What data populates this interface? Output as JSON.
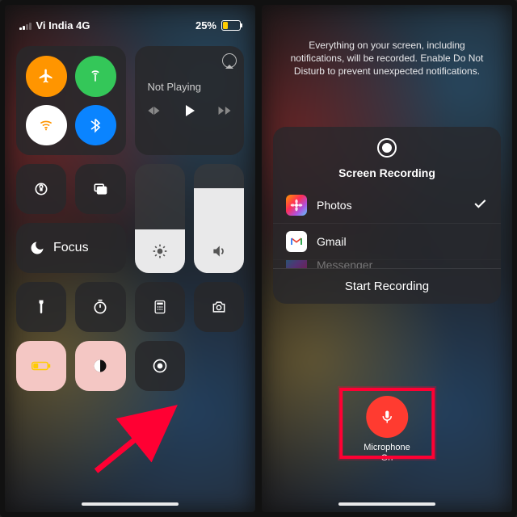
{
  "left": {
    "status": {
      "carrier": "Vi India 4G",
      "battery_pct": "25%"
    },
    "connectivity": {
      "airplane": {
        "enabled": true,
        "bg": "#ff9500"
      },
      "cellular": {
        "enabled": true,
        "bg": "#34c759"
      },
      "wifi": {
        "enabled": true,
        "bg": "#ffffff"
      },
      "bluetooth": {
        "enabled": true,
        "bg": "#0a84ff"
      }
    },
    "now_playing": {
      "title": "Not Playing"
    },
    "focus": {
      "label": "Focus"
    },
    "brightness": {
      "level": 0.4
    },
    "volume": {
      "level": 0.78
    },
    "row_icons": [
      "orientation-lock",
      "screen-mirroring"
    ],
    "bottom_row": [
      "flashlight",
      "timer",
      "calculator",
      "camera"
    ],
    "pink_row": [
      "low-power",
      "dark-mode",
      "screen-record"
    ]
  },
  "right": {
    "notice": "Everything on your screen, including notifications, will be recorded. Enable Do Not Disturb to prevent unexpected notifications.",
    "sheet": {
      "title": "Screen Recording",
      "apps": [
        {
          "name": "Photos",
          "selected": true
        },
        {
          "name": "Gmail",
          "selected": false
        },
        {
          "name": "Messenger",
          "selected": false
        }
      ],
      "action": "Start Recording"
    },
    "mic": {
      "label": "Microphone",
      "state": "On",
      "color": "#ff3b30"
    }
  }
}
